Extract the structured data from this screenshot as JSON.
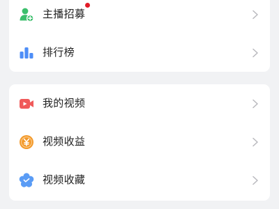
{
  "colors": {
    "background": "#f1f2f4",
    "card": "#ffffff",
    "text": "#222222",
    "chevron": "#b8b8bd",
    "notification_dot": "#e21c27",
    "green": "#3cbf6c",
    "blue": "#4e8ef7",
    "red": "#f05a5a",
    "orange": "#f39a2b",
    "light_blue": "#5a9cf5"
  },
  "group1": {
    "items": [
      {
        "label": "主播招募",
        "icon": "person-add-icon",
        "badge": "red-dot"
      },
      {
        "label": "排行榜",
        "icon": "bar-chart-icon"
      }
    ]
  },
  "group2": {
    "items": [
      {
        "label": "我的视频",
        "icon": "video-camera-icon"
      },
      {
        "label": "视频收益",
        "icon": "yuan-coin-icon"
      },
      {
        "label": "视频收藏",
        "icon": "flower-star-icon"
      }
    ]
  }
}
